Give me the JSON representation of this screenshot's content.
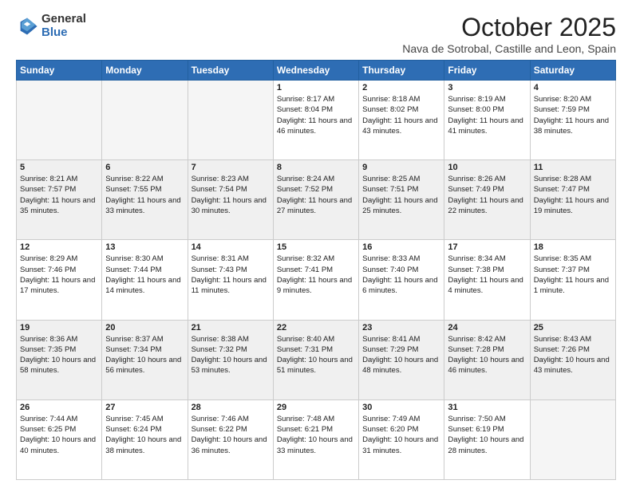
{
  "logo": {
    "general": "General",
    "blue": "Blue"
  },
  "header": {
    "month": "October 2025",
    "location": "Nava de Sotrobal, Castille and Leon, Spain"
  },
  "days_of_week": [
    "Sunday",
    "Monday",
    "Tuesday",
    "Wednesday",
    "Thursday",
    "Friday",
    "Saturday"
  ],
  "weeks": [
    [
      {
        "day": "",
        "info": ""
      },
      {
        "day": "",
        "info": ""
      },
      {
        "day": "",
        "info": ""
      },
      {
        "day": "1",
        "info": "Sunrise: 8:17 AM\nSunset: 8:04 PM\nDaylight: 11 hours and 46 minutes."
      },
      {
        "day": "2",
        "info": "Sunrise: 8:18 AM\nSunset: 8:02 PM\nDaylight: 11 hours and 43 minutes."
      },
      {
        "day": "3",
        "info": "Sunrise: 8:19 AM\nSunset: 8:00 PM\nDaylight: 11 hours and 41 minutes."
      },
      {
        "day": "4",
        "info": "Sunrise: 8:20 AM\nSunset: 7:59 PM\nDaylight: 11 hours and 38 minutes."
      }
    ],
    [
      {
        "day": "5",
        "info": "Sunrise: 8:21 AM\nSunset: 7:57 PM\nDaylight: 11 hours and 35 minutes."
      },
      {
        "day": "6",
        "info": "Sunrise: 8:22 AM\nSunset: 7:55 PM\nDaylight: 11 hours and 33 minutes."
      },
      {
        "day": "7",
        "info": "Sunrise: 8:23 AM\nSunset: 7:54 PM\nDaylight: 11 hours and 30 minutes."
      },
      {
        "day": "8",
        "info": "Sunrise: 8:24 AM\nSunset: 7:52 PM\nDaylight: 11 hours and 27 minutes."
      },
      {
        "day": "9",
        "info": "Sunrise: 8:25 AM\nSunset: 7:51 PM\nDaylight: 11 hours and 25 minutes."
      },
      {
        "day": "10",
        "info": "Sunrise: 8:26 AM\nSunset: 7:49 PM\nDaylight: 11 hours and 22 minutes."
      },
      {
        "day": "11",
        "info": "Sunrise: 8:28 AM\nSunset: 7:47 PM\nDaylight: 11 hours and 19 minutes."
      }
    ],
    [
      {
        "day": "12",
        "info": "Sunrise: 8:29 AM\nSunset: 7:46 PM\nDaylight: 11 hours and 17 minutes."
      },
      {
        "day": "13",
        "info": "Sunrise: 8:30 AM\nSunset: 7:44 PM\nDaylight: 11 hours and 14 minutes."
      },
      {
        "day": "14",
        "info": "Sunrise: 8:31 AM\nSunset: 7:43 PM\nDaylight: 11 hours and 11 minutes."
      },
      {
        "day": "15",
        "info": "Sunrise: 8:32 AM\nSunset: 7:41 PM\nDaylight: 11 hours and 9 minutes."
      },
      {
        "day": "16",
        "info": "Sunrise: 8:33 AM\nSunset: 7:40 PM\nDaylight: 11 hours and 6 minutes."
      },
      {
        "day": "17",
        "info": "Sunrise: 8:34 AM\nSunset: 7:38 PM\nDaylight: 11 hours and 4 minutes."
      },
      {
        "day": "18",
        "info": "Sunrise: 8:35 AM\nSunset: 7:37 PM\nDaylight: 11 hours and 1 minute."
      }
    ],
    [
      {
        "day": "19",
        "info": "Sunrise: 8:36 AM\nSunset: 7:35 PM\nDaylight: 10 hours and 58 minutes."
      },
      {
        "day": "20",
        "info": "Sunrise: 8:37 AM\nSunset: 7:34 PM\nDaylight: 10 hours and 56 minutes."
      },
      {
        "day": "21",
        "info": "Sunrise: 8:38 AM\nSunset: 7:32 PM\nDaylight: 10 hours and 53 minutes."
      },
      {
        "day": "22",
        "info": "Sunrise: 8:40 AM\nSunset: 7:31 PM\nDaylight: 10 hours and 51 minutes."
      },
      {
        "day": "23",
        "info": "Sunrise: 8:41 AM\nSunset: 7:29 PM\nDaylight: 10 hours and 48 minutes."
      },
      {
        "day": "24",
        "info": "Sunrise: 8:42 AM\nSunset: 7:28 PM\nDaylight: 10 hours and 46 minutes."
      },
      {
        "day": "25",
        "info": "Sunrise: 8:43 AM\nSunset: 7:26 PM\nDaylight: 10 hours and 43 minutes."
      }
    ],
    [
      {
        "day": "26",
        "info": "Sunrise: 7:44 AM\nSunset: 6:25 PM\nDaylight: 10 hours and 40 minutes."
      },
      {
        "day": "27",
        "info": "Sunrise: 7:45 AM\nSunset: 6:24 PM\nDaylight: 10 hours and 38 minutes."
      },
      {
        "day": "28",
        "info": "Sunrise: 7:46 AM\nSunset: 6:22 PM\nDaylight: 10 hours and 36 minutes."
      },
      {
        "day": "29",
        "info": "Sunrise: 7:48 AM\nSunset: 6:21 PM\nDaylight: 10 hours and 33 minutes."
      },
      {
        "day": "30",
        "info": "Sunrise: 7:49 AM\nSunset: 6:20 PM\nDaylight: 10 hours and 31 minutes."
      },
      {
        "day": "31",
        "info": "Sunrise: 7:50 AM\nSunset: 6:19 PM\nDaylight: 10 hours and 28 minutes."
      },
      {
        "day": "",
        "info": ""
      }
    ]
  ]
}
